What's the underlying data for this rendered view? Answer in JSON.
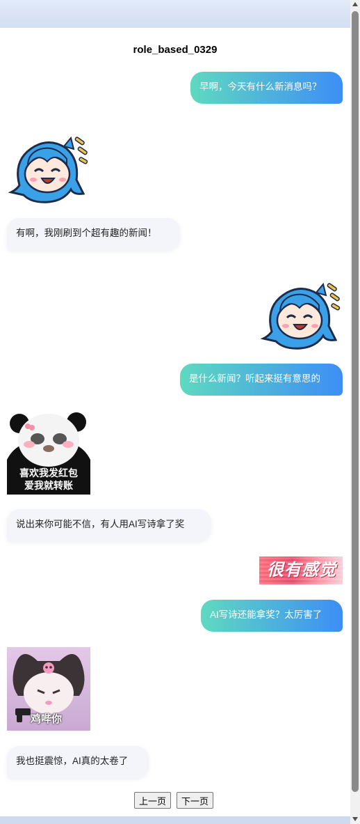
{
  "chat": {
    "title": "role_based_0329",
    "messages": [
      {
        "side": "right",
        "text": "早啊，今天有什么新消息吗？"
      },
      {
        "side": "left",
        "text": "有啊，我刚刷到个超有趣的新闻！"
      },
      {
        "side": "right",
        "text": "是什么新闻？听起来挺有意思的"
      },
      {
        "side": "left",
        "text": "说出来你可能不信，有人用AI写诗拿了奖"
      },
      {
        "side": "right",
        "text": "AI写诗还能拿奖？太厉害了"
      },
      {
        "side": "left",
        "text": "我也挺震惊，AI真的太卷了"
      }
    ],
    "stickers": {
      "panda_line1": "喜欢我发红包",
      "panda_line2": "爱我就转账",
      "banner_text": "很有感觉",
      "kuromi_caption": "鸡哔你"
    }
  },
  "pagination": {
    "prev_label": "上一页",
    "next_label": "下一页"
  },
  "colors": {
    "bubble_gradient_start": "#5fd9c0",
    "bubble_gradient_end": "#3d8ef5",
    "left_bubble": "#f3f5fa"
  }
}
